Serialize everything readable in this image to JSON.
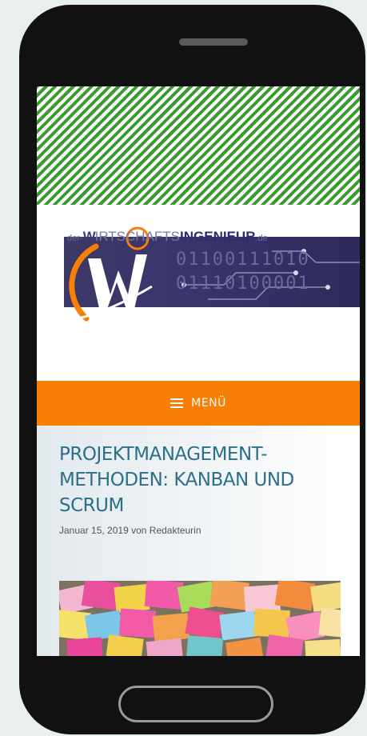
{
  "header": {
    "brand_prefix": "der-",
    "brand_w": "W",
    "brand_middle": "IRTSCHAFTS",
    "brand_strong": "INGENIEUR",
    "brand_suffix": ".de",
    "binary_line1": "01100111010",
    "binary_line2": "01110100001"
  },
  "nav": {
    "menu_label": "MENÜ",
    "menu_icon": "hamburger-icon"
  },
  "post": {
    "title": "PROJEKTMANAGEMENT-METHODEN: KANBAN UND SCRUM",
    "date": "Januar 15, 2019",
    "by": "von",
    "author": "Redakteurin"
  },
  "colors": {
    "accent_orange": "#f77f06",
    "title_blue": "#2c6f88",
    "stripe_green": "#3a9a2f",
    "banner_purple": "#3b3866"
  }
}
